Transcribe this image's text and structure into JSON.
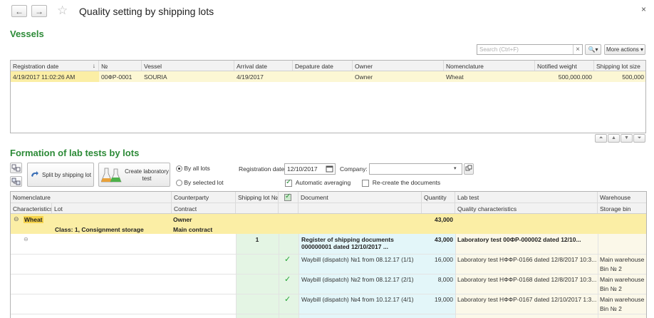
{
  "window": {
    "title": "Quality setting by shipping lots",
    "back": "←",
    "forward": "→",
    "star": "☆",
    "close": "×"
  },
  "vessels": {
    "title": "Vessels",
    "search_placeholder": "Search (Ctrl+F)",
    "search_clear": "×",
    "search_icon": "🔍▾",
    "more_actions": "More actions ▾",
    "columns": {
      "registration_date": "Registration date",
      "sort": "↓",
      "number": "№",
      "vessel": "Vessel",
      "arrival_date": "Arrival date",
      "departure_date": "Depature date",
      "owner": "Owner",
      "nomenclature": "Nomenclature",
      "notified_weight": "Notified weight",
      "shipping_lot_size": "Shipping lot size"
    },
    "row": {
      "registration_date": "4/19/2017 11:02:26 AM",
      "number": "00ФР-0001",
      "vessel": "SOURIA",
      "arrival_date": "4/19/2017",
      "departure_date": "",
      "owner": "Owner",
      "nomenclature": "Wheat",
      "notified_weight": "500,000.000",
      "shipping_lot_size": "500,000"
    },
    "scroll_buttons": [
      "⏶",
      "▲",
      "▼",
      "⏷"
    ]
  },
  "lab": {
    "title": "Formation of lab tests  by lots",
    "split_button": "Split by shipping lot",
    "create_button_line1": "Create laboratory",
    "create_button_line2": "test",
    "radio_all": "By all lots",
    "radio_selected": "By selected lot",
    "registration_date_label": "Registration date:",
    "registration_date_value": "12/10/2017",
    "company_label": "Company:",
    "company_value": "",
    "auto_averaging": "Automatic averaging",
    "recreate_docs": "Re-create the documents",
    "columns": {
      "nomenclature": "Nomenclature",
      "characteristics": "Characteristics",
      "lot": "Lot",
      "counterparty": "Counterparty",
      "contract": "Contract",
      "shipping_lot": "Shipping lot №",
      "document": "Document",
      "quantity": "Quantity",
      "lab_test": "Lab test",
      "quality_characteristics": "Quality characteristics",
      "warehouse": "Warehouse",
      "storage_bin": "Storage bin"
    },
    "group": {
      "toggle": "⊖",
      "nomenclature": "Wheat",
      "lot": "Class: 1, Consignment storage",
      "counterparty": "Owner",
      "contract": "Main contract",
      "quantity": "43,000"
    },
    "subgroup": {
      "toggle": "⊖",
      "shipping_lot": "1",
      "document_line1": "Register of shipping documents",
      "document_line2": "000000001 dated 12/10/2017 ...",
      "quantity": "43,000",
      "lab_test": "Laboratory test 00ФР-000002 dated 12/10..."
    },
    "rows": [
      {
        "check": "✓",
        "document": "Waybill (dispatch) №1 from 08.12.17 (1/1)",
        "quantity": "16,000",
        "lab_test": "Laboratory test НФФР-0166 dated 12/8/2017 10:3...",
        "warehouse": "Main warehouse",
        "bin": "Bin № 2"
      },
      {
        "check": "✓",
        "document": "Waybill (dispatch) №2 from 08.12.17 (2/1)",
        "quantity": "8,000",
        "lab_test": "Laboratory test НФФР-0168 dated 12/8/2017 10:3...",
        "warehouse": "Main warehouse",
        "bin": "Bin № 2"
      },
      {
        "check": "✓",
        "document": "Waybill (dispatch) №4 from 10.12.17 (4/1)",
        "quantity": "19,000",
        "lab_test": "Laboratory test НФФР-0167 dated 12/10/2017 1:3...",
        "warehouse": "Main warehouse",
        "bin": "Bin № 2"
      }
    ]
  }
}
